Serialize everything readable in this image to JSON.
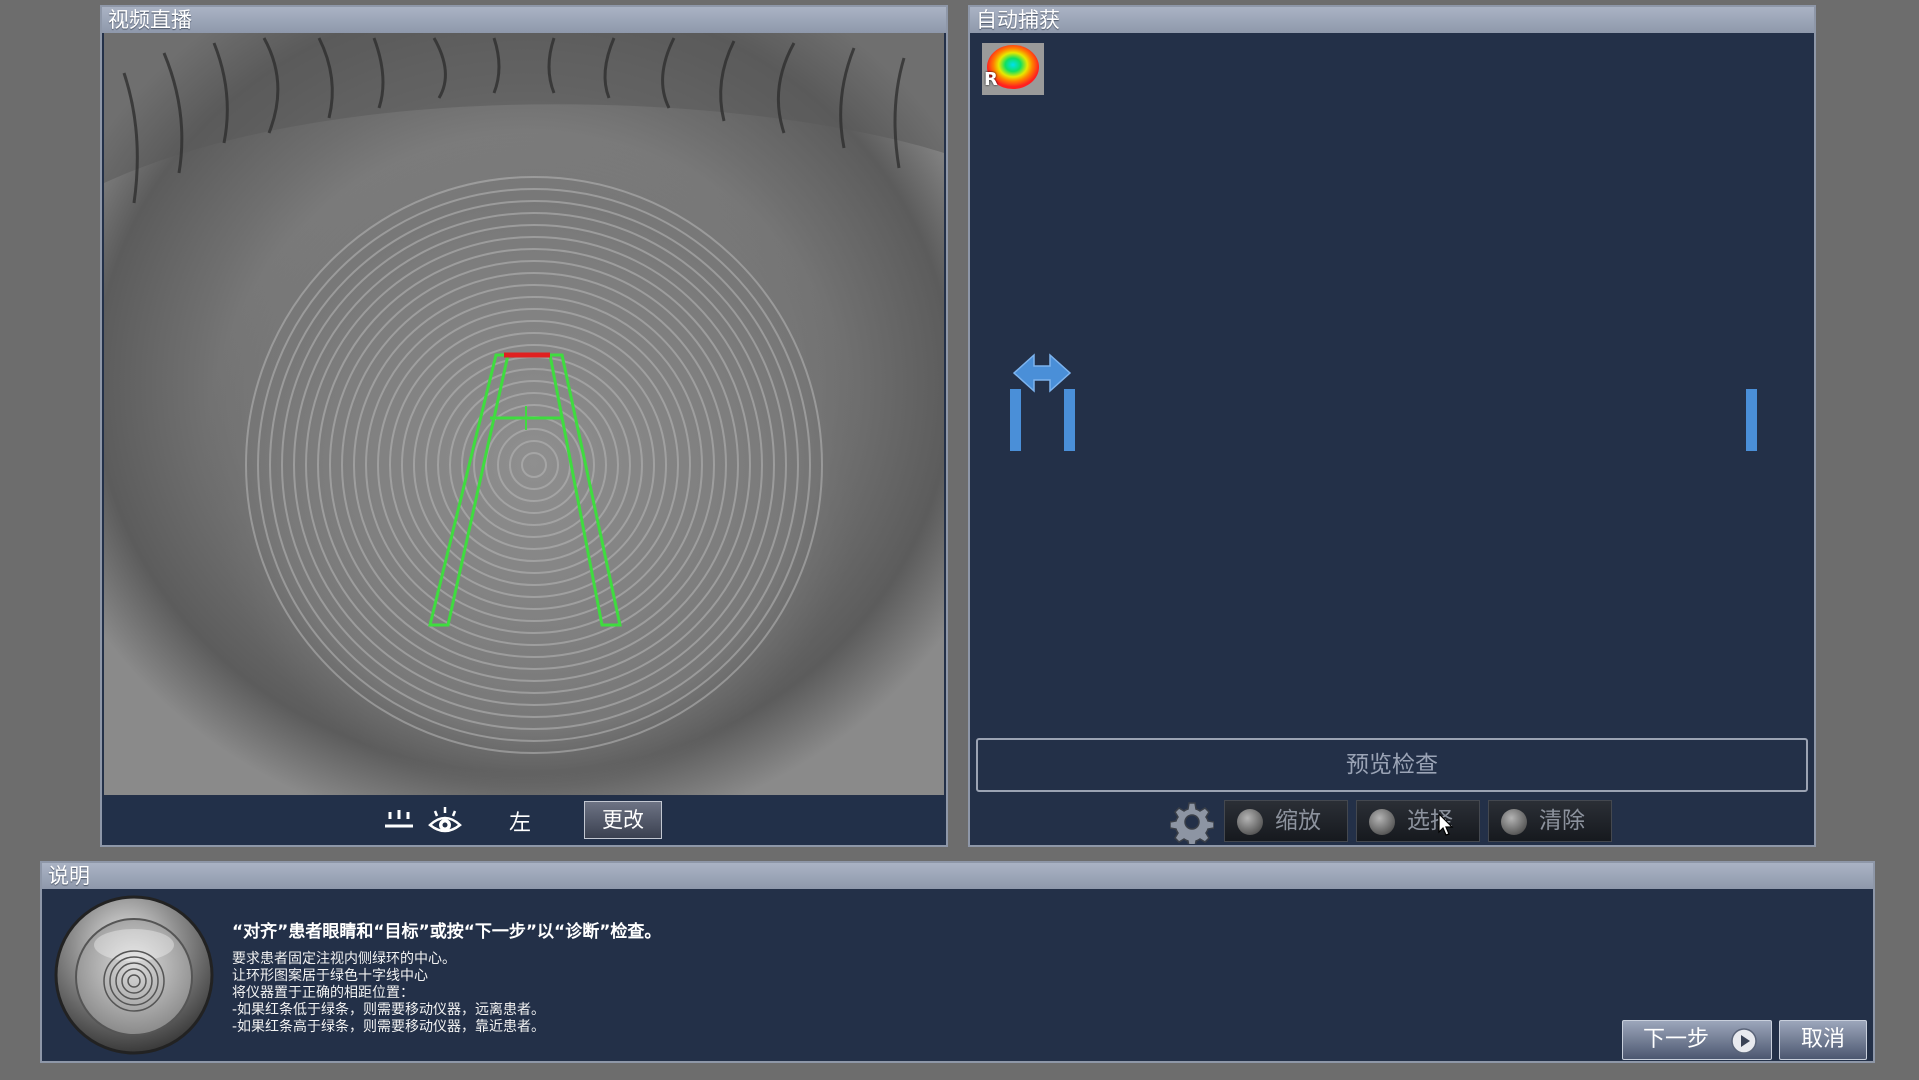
{
  "live": {
    "title": "视频直播",
    "eye_side": "左",
    "change_label": "更改"
  },
  "capture": {
    "title": "自动捕获",
    "eye_badge": "R",
    "preview_label": "预览检查",
    "zoom_label": "缩放",
    "select_label": "选择",
    "clear_label": "清除"
  },
  "info": {
    "title": "说明",
    "heading": "“对齐”患者眼睛和“目标”或按“下一步”以“诊断”检查。",
    "lines": [
      "要求患者固定注视内侧绿环的中心。",
      "让环形图案居于绿色十字线中心",
      "将仪器置于正确的相距位置：",
      "-如果红条低于绿条，则需要移动仪器，远离患者。",
      "-如果红条高于绿条，则需要移动仪器，靠近患者。"
    ]
  },
  "buttons": {
    "next_label": "下一步",
    "cancel_label": "取消"
  },
  "colors": {
    "panel_bg": "#233048",
    "overlay_green": "#3fdc3f",
    "distance_red": "#e02020",
    "indicator_blue": "#4a8fd8"
  },
  "icons": [
    "eyelid-icon",
    "eye-icon",
    "gear-icon",
    "play-icon",
    "eye-heatmap-icon",
    "double-arrow-icon",
    "target-lens-icon"
  ]
}
